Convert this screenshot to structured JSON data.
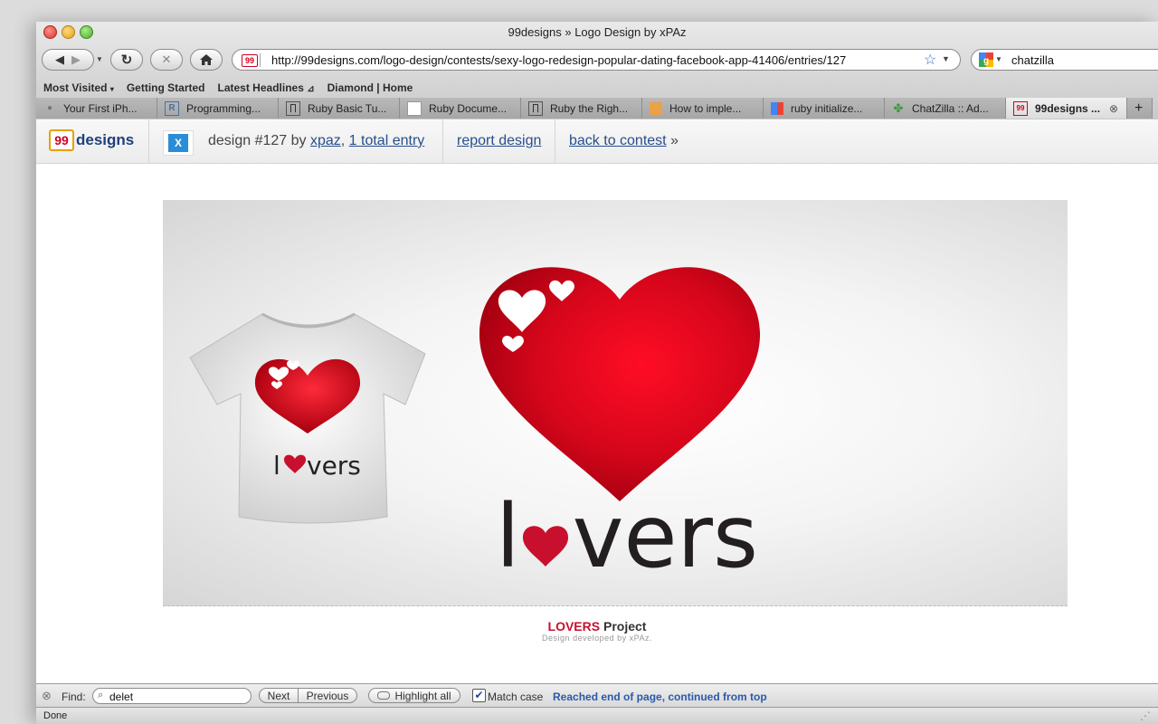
{
  "window": {
    "title": "99designs » Logo Design by xPAz"
  },
  "toolbar": {
    "url": "http://99designs.com/logo-design/contests/sexy-logo-redesign-popular-dating-facebook-app-41406/entries/127",
    "search_value": "chatzilla",
    "site_badge": "99"
  },
  "bookmarks": [
    "Most Visited",
    "Getting Started",
    "Latest Headlines",
    "Diamond | Home"
  ],
  "tabs": [
    {
      "label": "Your First iPh...",
      "icon": "apple-icon"
    },
    {
      "label": "Programming...",
      "icon": "r-icon"
    },
    {
      "label": "Ruby Basic Tu...",
      "icon": "page-icon"
    },
    {
      "label": "Ruby Docume...",
      "icon": "document-icon"
    },
    {
      "label": "Ruby the Righ...",
      "icon": "page-icon"
    },
    {
      "label": "How to imple...",
      "icon": "stack-icon"
    },
    {
      "label": "ruby initialize...",
      "icon": "google-icon"
    },
    {
      "label": "ChatZilla :: Ad...",
      "icon": "puzzle-icon"
    },
    {
      "label": "99designs ...",
      "icon": "99-icon",
      "active": true
    }
  ],
  "header": {
    "logo_box": "99",
    "logo_word": "designs",
    "avatar_letter": "X",
    "design_prefix": "design #127 by",
    "designer": "xpaz",
    "entries": "1 total entry",
    "report": "report design",
    "back": "back to contest",
    "back_arrow": "»"
  },
  "design": {
    "wordmark_l": "l",
    "wordmark_rest": "vers",
    "caption_brand": "LOVERS",
    "caption_rest": "Project",
    "caption_sub": "Design developed by xPAz."
  },
  "findbar": {
    "label": "Find:",
    "value": "delet",
    "next": "Next",
    "previous": "Previous",
    "highlight": "Highlight all",
    "match_case": "Match case",
    "status": "Reached end of page, continued from top"
  },
  "status": {
    "text": "Done"
  },
  "colors": {
    "brand_red": "#c8102e",
    "link": "#284f8a"
  }
}
